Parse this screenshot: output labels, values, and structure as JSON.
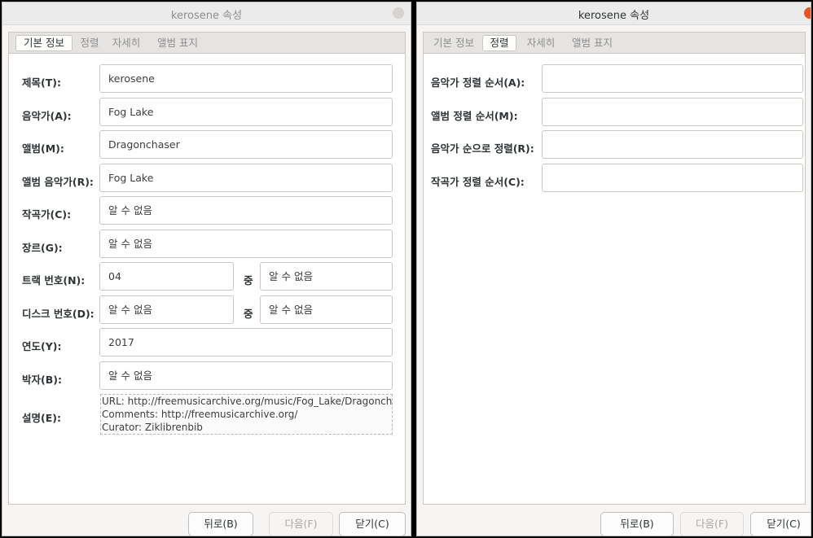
{
  "left_window": {
    "title": "kerosene 속성",
    "tabs": [
      "기본 정보",
      "정렬",
      "자세히",
      "앨범 표지"
    ],
    "fields": {
      "title": {
        "label": "제목(T):",
        "value": "kerosene"
      },
      "artist": {
        "label": "음악가(A):",
        "value": "Fog Lake"
      },
      "album": {
        "label": "앨범(M):",
        "value": "Dragonchaser"
      },
      "album_artist": {
        "label": "앨범 음악가(R):",
        "value": "Fog Lake"
      },
      "composer": {
        "label": "작곡가(C):",
        "value": "알 수 없음"
      },
      "genre": {
        "label": "장르(G):",
        "value": "알 수 없음"
      },
      "track": {
        "label": "트랙 번호(N):",
        "value": "04",
        "of_label": "중",
        "total": "알 수 없음"
      },
      "disc": {
        "label": "디스크 번호(D):",
        "value": "알 수 없음",
        "of_label": "중",
        "total": "알 수 없음"
      },
      "year": {
        "label": "연도(Y):",
        "value": "2017"
      },
      "bpm": {
        "label": "박자(B):",
        "value": "알 수 없음"
      },
      "comment": {
        "label": "설명(E):",
        "lines": [
          "URL: http://freemusicarchive.org/music/Fog_Lake/Dragonch",
          "Comments: http://freemusicarchive.org/",
          "Curator: Ziklibrenbib"
        ]
      }
    },
    "buttons": {
      "back": "뒤로(B)",
      "next": "다음(F)",
      "close": "닫기(C)"
    }
  },
  "right_window": {
    "title": "kerosene 속성",
    "tabs": [
      "기본 정보",
      "정렬",
      "자세히",
      "앨범 표지"
    ],
    "fields": {
      "artist_sort": {
        "label": "음악가 정렬 순서(A):",
        "value": ""
      },
      "album_sort": {
        "label": "앨범 정렬 순서(M):",
        "value": ""
      },
      "album_artist_sort": {
        "label": "음악가 순으로 정렬(R):",
        "value": ""
      },
      "composer_sort": {
        "label": "작곡가 정렬 순서(C):",
        "value": ""
      }
    },
    "buttons": {
      "back": "뒤로(B)",
      "next": "다음(F)",
      "close": "닫기(C)"
    }
  },
  "colors": {
    "close_active": "#e95420",
    "window_bg": "#f6f5f4",
    "tab_bar": "#e6e4e2"
  }
}
